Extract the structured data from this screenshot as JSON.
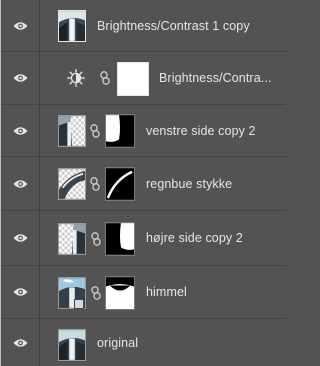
{
  "layers": [
    {
      "name": "Brightness/Contrast 1 copy",
      "eye_icon": "eye-icon"
    },
    {
      "name": "Brightness/Contra...",
      "eye_icon": "eye-icon",
      "adjustment_icon": "brightness-contrast-icon",
      "link_icon": "chain-link-icon"
    },
    {
      "name": "venstre side copy 2",
      "eye_icon": "eye-icon",
      "link_icon": "chain-link-icon"
    },
    {
      "name": "regnbue stykke",
      "eye_icon": "eye-icon",
      "link_icon": "chain-link-icon"
    },
    {
      "name": "højre side copy 2",
      "eye_icon": "eye-icon",
      "link_icon": "chain-link-icon"
    },
    {
      "name": "himmel",
      "eye_icon": "eye-icon",
      "link_icon": "chain-link-icon",
      "smart_object_icon": "smart-object-icon"
    },
    {
      "name": "original",
      "eye_icon": "eye-icon"
    }
  ],
  "colors": {
    "panel_bg": "#535353",
    "divider": "#434343",
    "text": "#e6e6e6"
  }
}
